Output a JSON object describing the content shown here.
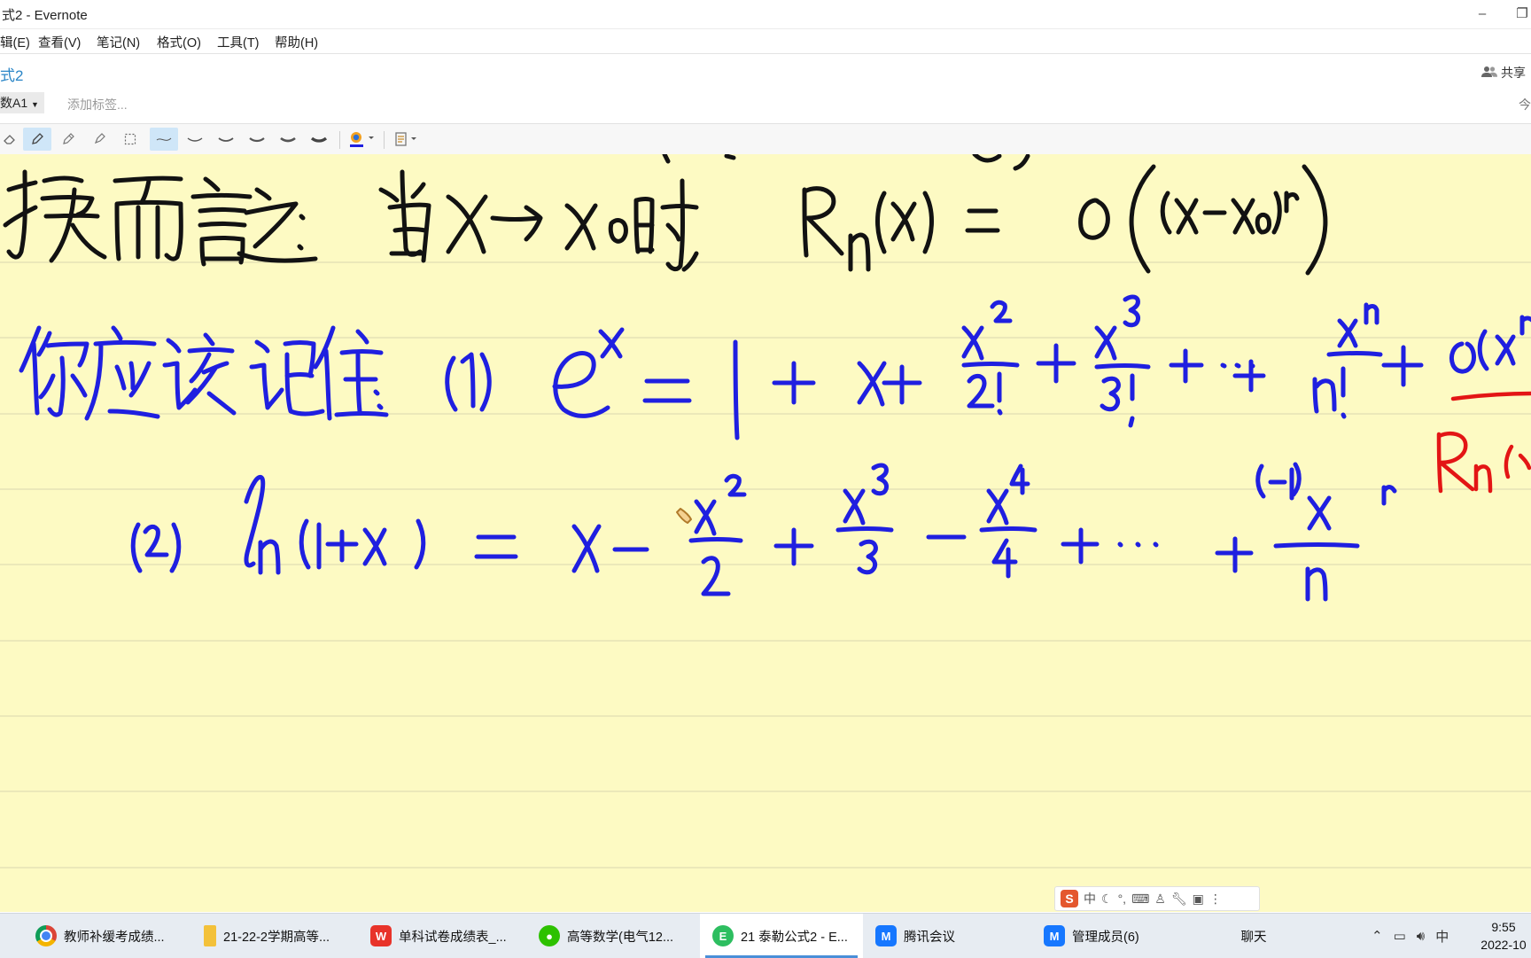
{
  "window": {
    "title": "式2 - Evernote",
    "minimize_glyph": "–",
    "restore_glyph": "❐"
  },
  "menu": [
    "辑(E)",
    "查看(V)",
    "笔记(N)",
    "格式(O)",
    "工具(T)",
    "帮助(H)"
  ],
  "note": {
    "title": "式2",
    "share_label": "共享",
    "notebook": "数A1",
    "add_tag_placeholder": "添加标签...",
    "date_partial": "今"
  },
  "toolbar": {
    "tools": [
      "eraser-icon",
      "pen-icon",
      "pencil-icon",
      "highlighter-icon",
      "lasso-select-icon",
      "stroke-thin-icon",
      "stroke-2-icon",
      "stroke-3-icon",
      "stroke-4-icon",
      "stroke-5-icon",
      "stroke-6-icon",
      "color-picker-icon",
      "paper-style-icon"
    ],
    "active_tools": [
      "pen-icon",
      "stroke-thin-icon"
    ],
    "color_swatch": "#1f1fe0"
  },
  "ink": {
    "paper_color": "#fdfac3",
    "colors": {
      "black": "#121212",
      "blue": "#1f1fe0",
      "red": "#e31515"
    }
  },
  "ime_bar": {
    "logo": "S",
    "mode": "中"
  },
  "taskbar": {
    "items": [
      {
        "label": "教师补缓考成绩...",
        "icon": "chrome-icon"
      },
      {
        "label": "21-22-2学期高等...",
        "icon": "folder-icon"
      },
      {
        "label": "单科试卷成绩表_...",
        "icon": "wps-icon"
      },
      {
        "label": "高等数学(电气12...",
        "icon": "wechat-icon"
      },
      {
        "label": "21 泰勒公式2 - E...",
        "icon": "evernote-icon",
        "active": true
      },
      {
        "label": "腾讯会议",
        "icon": "tencent-meeting-icon"
      },
      {
        "label": "管理成员(6)",
        "icon": "tencent-meeting-icon"
      },
      {
        "label": "聊天",
        "icon": ""
      }
    ],
    "tray_ime": "中",
    "time": "9:55",
    "date": "2022-10"
  }
}
